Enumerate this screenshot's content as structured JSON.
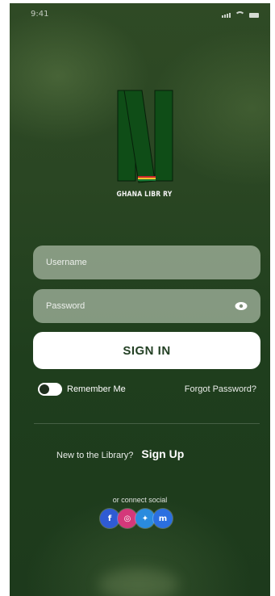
{
  "status_bar": {
    "time": "9:41",
    "signal_icon": "signal-icon",
    "wifi_icon": "wifi-icon",
    "battery_icon": "battery-icon"
  },
  "logo": {
    "caption": "GHANA LIBR  RY",
    "colors": {
      "bar": "#0f4d17",
      "stripe_red": "#c8262b",
      "stripe_gold": "#f2c230",
      "stripe_green": "#1a7a35"
    }
  },
  "form": {
    "username_placeholder": "Username",
    "username_value": "",
    "password_placeholder": "Password",
    "password_value": "",
    "password_toggle_icon": "eye-icon",
    "sign_in_label": "SIGN IN",
    "remember_label": "Remember Me",
    "remember_on": true,
    "forgot_label": "Forgot Password?"
  },
  "signup": {
    "prompt": "New to the Library?",
    "link_label": "Sign Up"
  },
  "social": {
    "label": "or connect social",
    "buttons": [
      {
        "icon": "facebook-icon",
        "glyph": "f",
        "color": "#2f5bd3"
      },
      {
        "icon": "instagram-icon",
        "glyph": "◎",
        "color": "#d4387a"
      },
      {
        "icon": "twitter-icon",
        "glyph": "✦",
        "color": "#2a8bde"
      },
      {
        "icon": "messenger-icon",
        "glyph": "m",
        "color": "#2b6fe0"
      }
    ]
  },
  "colors": {
    "background": "#24401f",
    "accent_text": "#234024"
  }
}
